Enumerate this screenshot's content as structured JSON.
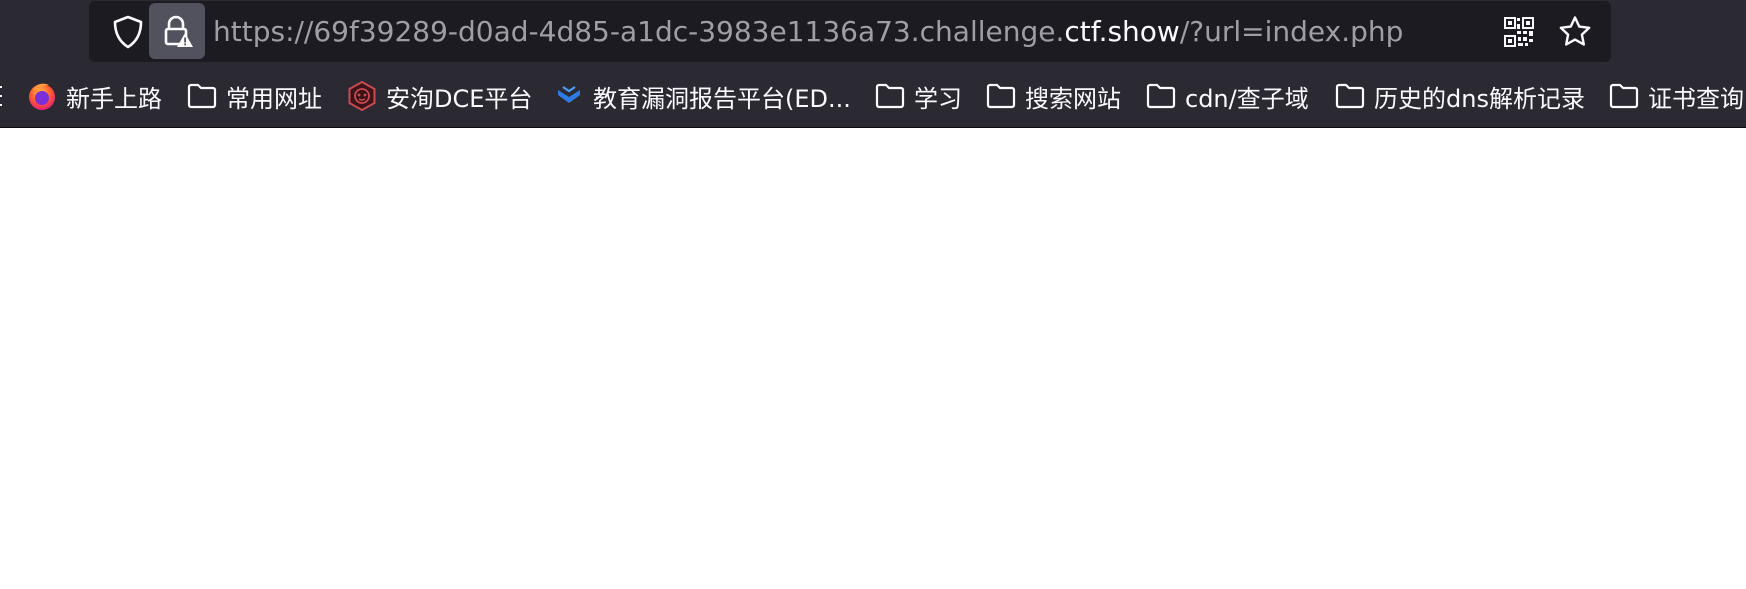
{
  "address_bar": {
    "url_prefix": "https://69f39289-d0ad-4d85-a1dc-3983e1136a73.challenge.",
    "url_host": "ctf.show",
    "url_suffix": "/?url=index.php",
    "shield_icon": "shield-icon",
    "lock_icon": "lock-warning-icon",
    "qr_icon": "qr-code-icon",
    "bookmark_icon": "star-icon"
  },
  "bookmarks": [
    {
      "label": "新手上路",
      "icon": "firefox-icon"
    },
    {
      "label": "常用网址",
      "icon": "folder-icon"
    },
    {
      "label": "安洵DCE平台",
      "icon": "monkey-logo-icon"
    },
    {
      "label": "教育漏洞报告平台(ED...",
      "icon": "edu-logo-icon"
    },
    {
      "label": "学习",
      "icon": "folder-icon"
    },
    {
      "label": "搜索网站",
      "icon": "folder-icon"
    },
    {
      "label": "cdn/查子域",
      "icon": "folder-icon"
    },
    {
      "label": "历史的dns解析记录",
      "icon": "folder-icon"
    },
    {
      "label": "证书查询",
      "icon": "folder-icon"
    }
  ],
  "colors": {
    "toolbar_bg": "#2b2a33",
    "urlbar_bg": "#1c1b22",
    "url_dim": "#9e9ea6",
    "url_bright": "#fbfbfe",
    "page_bg": "#ffffff"
  }
}
